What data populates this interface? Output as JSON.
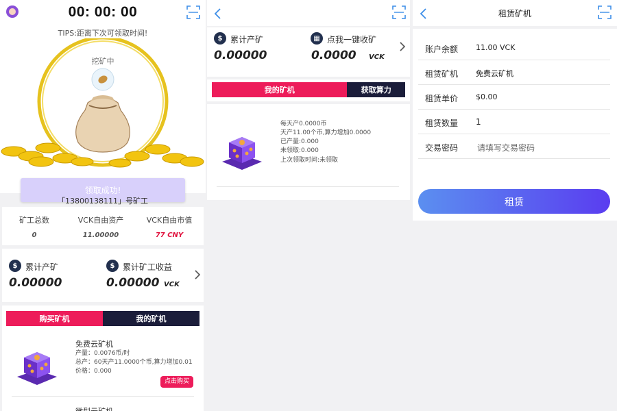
{
  "panel1": {
    "timer": "00: 00: 00",
    "tips": "TIPS:距离下次可领取时间!",
    "mining_status": "挖矿中",
    "claim_button": "领取成功!",
    "miner_account": "「13800138111」号矿工",
    "stats": [
      {
        "label": "矿工总数",
        "value": "0"
      },
      {
        "label": "VCK自由资产",
        "value": "11.00000"
      },
      {
        "label": "VCK自由市值",
        "value": "77 CNY"
      }
    ],
    "totals": {
      "left_label": "累计产矿",
      "left_value": "0.00000",
      "right_label": "累计矿工收益",
      "right_value": "0.00000",
      "unit": "VCK"
    },
    "tabs": [
      "购买矿机",
      "我的矿机"
    ],
    "machine": {
      "name": "免费云矿机",
      "output": "产量：0.0076币/时",
      "total": "总产：60天产11.0000个币,算力增加0.01",
      "price": "价格：0.000",
      "buy_label": "点击购买"
    },
    "machine2_name": "微型云矿机",
    "coin_icon": "$"
  },
  "panel2": {
    "totals": {
      "left_label": "累计产矿",
      "left_value": "0.00000",
      "right_label": "点我一键收矿",
      "right_value": "0.0000",
      "unit": "VCK"
    },
    "tabs": [
      "我的矿机",
      "获取算力"
    ],
    "machine_lines": [
      "每天产0.0000币",
      "天产11.00个币,算力增加0.0000",
      "已产量:0.000",
      "未领取:0.000",
      "上次领取时间:未领取"
    ]
  },
  "panel3": {
    "title": "租赁矿机",
    "rows": [
      {
        "label": "账户余额",
        "value": "11.00 VCK"
      },
      {
        "label": "租赁矿机",
        "value": "免费云矿机"
      },
      {
        "label": "租赁单价",
        "value": "$0.00"
      },
      {
        "label": "租赁数量",
        "value": "1"
      },
      {
        "label": "交易密码",
        "value": "请填写交易密码"
      }
    ],
    "submit": "租赁"
  },
  "colors": {
    "tab_active": "#ed1c5a",
    "tab_inactive": "#1b1d3a",
    "price_red": "#e0103c",
    "accent_blue": "#3d8ee8",
    "button_gradient_start": "#5b8ff0",
    "button_gradient_end": "#5a3df0"
  }
}
